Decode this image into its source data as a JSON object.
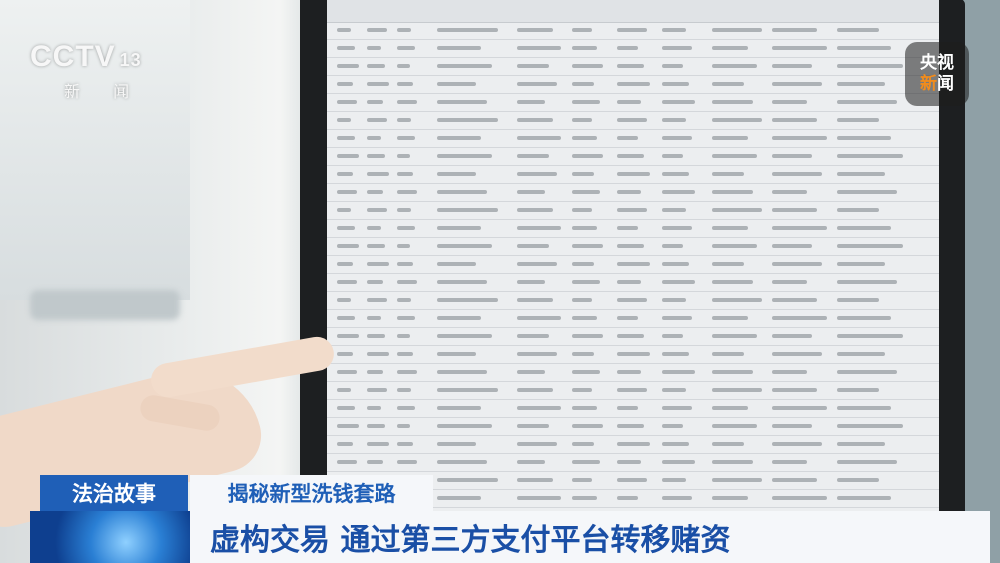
{
  "watermark": {
    "brand": "CCTV",
    "channel": "13",
    "sub": "新 闻"
  },
  "badge": {
    "line1": "央视",
    "line2_a": "新",
    "line2_b": "闻"
  },
  "lower_third": {
    "tag1": "法治故事",
    "tag2": "揭秘新型洗钱套路",
    "headline": "虚构交易 通过第三方支付平台转移赌资"
  },
  "colors": {
    "accent_blue": "#1f5fb7",
    "badge_orange": "#f28c1c"
  }
}
